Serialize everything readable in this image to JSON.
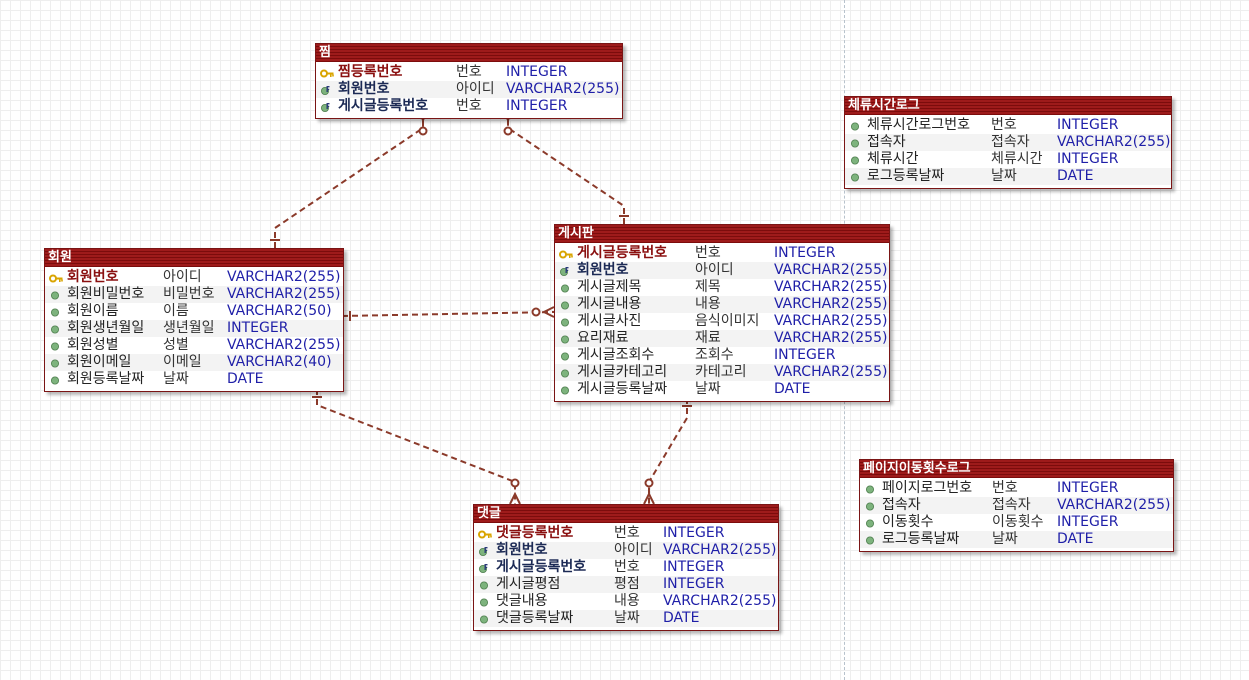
{
  "entities": [
    {
      "id": "jjim",
      "title": "찜",
      "columns": [
        {
          "name": "찜등록번호",
          "logical": "번호",
          "type": "INTEGER",
          "kind": "pk"
        },
        {
          "name": "회원번호",
          "logical": "아이디",
          "type": "VARCHAR2(255)",
          "kind": "fk"
        },
        {
          "name": "게시글등록번호",
          "logical": "번호",
          "type": "INTEGER",
          "kind": "fk"
        }
      ]
    },
    {
      "id": "member",
      "title": "회원",
      "columns": [
        {
          "name": "회원번호",
          "logical": "아이디",
          "type": "VARCHAR2(255)",
          "kind": "pk"
        },
        {
          "name": "회원비밀번호",
          "logical": "비밀번호",
          "type": "VARCHAR2(255)",
          "kind": "attr"
        },
        {
          "name": "회원이름",
          "logical": "이름",
          "type": "VARCHAR2(50)",
          "kind": "attr"
        },
        {
          "name": "회원생년월일",
          "logical": "생년월일",
          "type": "INTEGER",
          "kind": "attr"
        },
        {
          "name": "회원성별",
          "logical": "성별",
          "type": "VARCHAR2(255)",
          "kind": "attr"
        },
        {
          "name": "회원이메일",
          "logical": "이메일",
          "type": "VARCHAR2(40)",
          "kind": "attr"
        },
        {
          "name": "회원등록날짜",
          "logical": "날짜",
          "type": "DATE",
          "kind": "attr"
        }
      ]
    },
    {
      "id": "board",
      "title": "게시판",
      "columns": [
        {
          "name": "게시글등록번호",
          "logical": "번호",
          "type": "INTEGER",
          "kind": "pk"
        },
        {
          "name": "회원번호",
          "logical": "아이디",
          "type": "VARCHAR2(255)",
          "kind": "fk"
        },
        {
          "name": "게시글제목",
          "logical": "제목",
          "type": "VARCHAR2(255)",
          "kind": "attr"
        },
        {
          "name": "게시글내용",
          "logical": "내용",
          "type": "VARCHAR2(255)",
          "kind": "attr"
        },
        {
          "name": "게시글사진",
          "logical": "음식이미지",
          "type": "VARCHAR2(255)",
          "kind": "attr"
        },
        {
          "name": "요리재료",
          "logical": "재료",
          "type": "VARCHAR2(255)",
          "kind": "attr"
        },
        {
          "name": "게시글조회수",
          "logical": "조회수",
          "type": "INTEGER",
          "kind": "attr"
        },
        {
          "name": "게시글카테고리",
          "logical": "카테고리",
          "type": "VARCHAR2(255)",
          "kind": "attr"
        },
        {
          "name": "게시글등록날짜",
          "logical": "날짜",
          "type": "DATE",
          "kind": "attr"
        }
      ]
    },
    {
      "id": "comment",
      "title": "댓글",
      "columns": [
        {
          "name": "댓글등록번호",
          "logical": "번호",
          "type": "INTEGER",
          "kind": "pk"
        },
        {
          "name": "회원번호",
          "logical": "아이디",
          "type": "VARCHAR2(255)",
          "kind": "fk"
        },
        {
          "name": "게시글등록번호",
          "logical": "번호",
          "type": "INTEGER",
          "kind": "fk"
        },
        {
          "name": "게시글평점",
          "logical": "평점",
          "type": "INTEGER",
          "kind": "attr"
        },
        {
          "name": "댓글내용",
          "logical": "내용",
          "type": "VARCHAR2(255)",
          "kind": "attr"
        },
        {
          "name": "댓글등록날짜",
          "logical": "날짜",
          "type": "DATE",
          "kind": "attr"
        }
      ]
    },
    {
      "id": "staylog",
      "title": "체류시간로그",
      "columns": [
        {
          "name": "체류시간로그번호",
          "logical": "번호",
          "type": "INTEGER",
          "kind": "attr"
        },
        {
          "name": "접속자",
          "logical": "접속자",
          "type": "VARCHAR2(255)",
          "kind": "attr"
        },
        {
          "name": "체류시간",
          "logical": "체류시간",
          "type": "INTEGER",
          "kind": "attr"
        },
        {
          "name": "로그등록날짜",
          "logical": "날짜",
          "type": "DATE",
          "kind": "attr"
        }
      ]
    },
    {
      "id": "pagelog",
      "title": "페이지이동횟수로그",
      "columns": [
        {
          "name": "페이지로그번호",
          "logical": "번호",
          "type": "INTEGER",
          "kind": "attr"
        },
        {
          "name": "접속자",
          "logical": "접속자",
          "type": "VARCHAR2(255)",
          "kind": "attr"
        },
        {
          "name": "이동횟수",
          "logical": "이동횟수",
          "type": "INTEGER",
          "kind": "attr"
        },
        {
          "name": "로그등록날짜",
          "logical": "날짜",
          "type": "DATE",
          "kind": "attr"
        }
      ]
    }
  ],
  "relationships": [
    {
      "id": "member-jjim",
      "parent": "member",
      "child": "jjim",
      "cardinality": "zero-or-many"
    },
    {
      "id": "board-jjim",
      "parent": "board",
      "child": "jjim",
      "cardinality": "zero-or-many"
    },
    {
      "id": "member-board",
      "parent": "member",
      "child": "board",
      "cardinality": "zero-or-many"
    },
    {
      "id": "member-comment",
      "parent": "member",
      "child": "comment",
      "cardinality": "zero-or-many"
    },
    {
      "id": "board-comment",
      "parent": "board",
      "child": "comment",
      "cardinality": "zero-or-many"
    }
  ],
  "colors": {
    "header": "#9e1b1b",
    "border": "#7a1515",
    "relationship_line": "#8b3a2a",
    "type_text": "#1f1fa8",
    "pk_text": "#8a0f0f",
    "fk_text": "#1c2a55",
    "pk_icon": "#d9a400",
    "attr_icon": "#7db37d",
    "fk_icon": "#2a3a78"
  },
  "icons": {
    "pk": "key-icon",
    "fk": "foreign-key-icon",
    "attr": "attribute-dot-icon"
  }
}
